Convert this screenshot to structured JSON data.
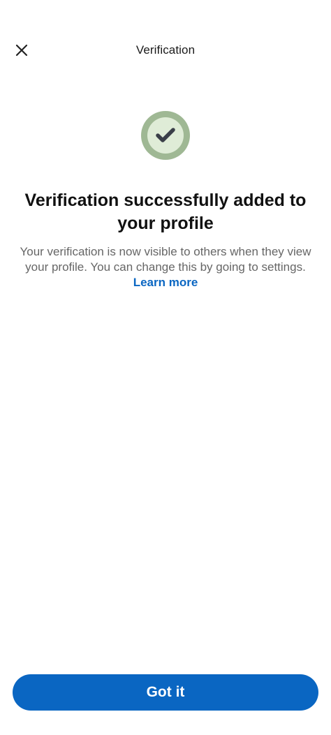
{
  "header": {
    "title": "Verification",
    "close_icon": "close-icon"
  },
  "badge": {
    "icon": "checkmark-icon",
    "outer_ring_color": "#9fb894",
    "inner_fill_color": "#dfecd7",
    "check_color": "#3a3f48"
  },
  "content": {
    "headline": "Verification successfully added to your profile",
    "body": "Your verification is now visible to others when they view your profile. You can change this by going to settings.",
    "link_label": "Learn more"
  },
  "footer": {
    "primary_button_label": "Got it"
  },
  "colors": {
    "accent": "#0a66c2",
    "text_primary": "#111111",
    "text_secondary": "#666666"
  }
}
